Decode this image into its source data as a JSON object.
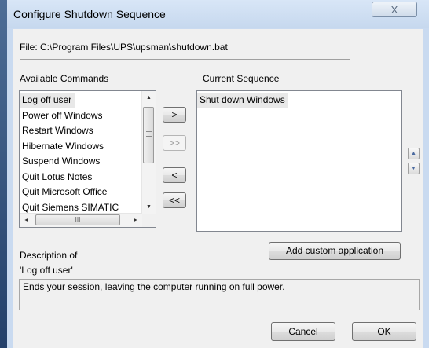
{
  "window": {
    "title": "Configure Shutdown Sequence",
    "close_glyph": "X"
  },
  "file_label": "File: C:\\Program Files\\UPS\\upsman\\shutdown.bat",
  "available": {
    "label": "Available Commands",
    "items": [
      "Log off user",
      "Power off Windows",
      "Restart Windows",
      "Hibernate Windows",
      "Suspend Windows",
      "Quit Lotus Notes",
      "Quit Microsoft Office",
      "Quit Siemens SIMATIC"
    ],
    "selected_index": 0
  },
  "current": {
    "label": "Current Sequence",
    "items": [
      "Shut down Windows"
    ]
  },
  "buttons": {
    "add": ">",
    "add_all": ">>",
    "remove": "<",
    "remove_all": "<<",
    "add_custom": "Add custom application",
    "cancel": "Cancel",
    "ok": "OK"
  },
  "scroll": {
    "up": "▲",
    "down": "▼",
    "left": "◄",
    "right": "►",
    "thumb_grip": "III"
  },
  "description": {
    "heading": "Description of",
    "subject": "'Log off user'",
    "text": "Ends your session, leaving the computer running on full power."
  },
  "icons": {
    "move_up": "up-arrow-icon",
    "move_down": "down-arrow-icon"
  },
  "colors": {
    "client_bg": "#f0f0f0",
    "frame": "#c9daf0",
    "selection": "#e8e8e8"
  }
}
